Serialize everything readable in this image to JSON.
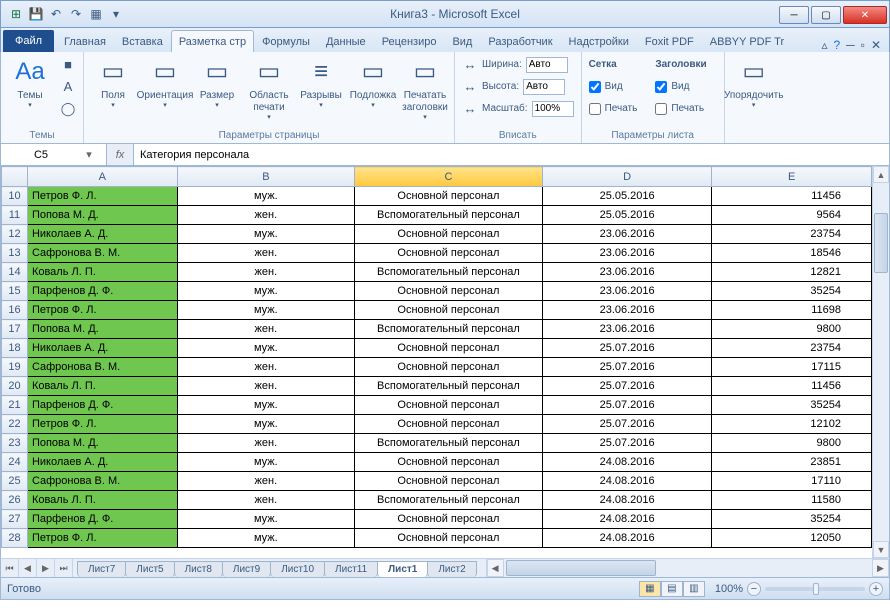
{
  "title": "Книга3  -  Microsoft Excel",
  "qat_icons": [
    "excel",
    "save",
    "undo",
    "redo",
    "print-area",
    "customize"
  ],
  "tabs": {
    "file": "Файл",
    "items": [
      "Главная",
      "Вставка",
      "Разметка стр",
      "Формулы",
      "Данные",
      "Рецензиро",
      "Вид",
      "Разработчик",
      "Надстройки",
      "Foxit PDF",
      "ABBYY PDF Tr"
    ],
    "active_index": 2
  },
  "ribbon": {
    "groups": [
      {
        "label": "Темы",
        "big": [
          {
            "icon": "Aa",
            "text": "Темы"
          }
        ],
        "side": [
          "■",
          "A",
          "◯"
        ]
      },
      {
        "label": "Параметры страницы",
        "big": [
          {
            "icon": "▭",
            "text": "Поля"
          },
          {
            "icon": "▭",
            "text": "Ориентация"
          },
          {
            "icon": "▭",
            "text": "Размер"
          },
          {
            "icon": "▭",
            "text": "Область печати"
          },
          {
            "icon": "≡",
            "text": "Разрывы"
          },
          {
            "icon": "▭",
            "text": "Подложка"
          },
          {
            "icon": "▭",
            "text": "Печатать заголовки"
          }
        ]
      },
      {
        "label": "Вписать",
        "rows": [
          {
            "label": "Ширина:",
            "val": "Авто"
          },
          {
            "label": "Высота:",
            "val": "Авто"
          },
          {
            "label": "Масштаб:",
            "val": "100%"
          }
        ]
      },
      {
        "label": "Параметры листа",
        "cols": [
          {
            "head": "Сетка",
            "c1": "Вид",
            "c2": "Печать"
          },
          {
            "head": "Заголовки",
            "c1": "Вид",
            "c2": "Печать"
          }
        ]
      },
      {
        "label": "",
        "big": [
          {
            "icon": "▭",
            "text": "Упорядочить"
          }
        ]
      }
    ]
  },
  "namebox": "C5",
  "formula": "Категория персонала",
  "columns": [
    "A",
    "B",
    "C",
    "D",
    "E"
  ],
  "selected_col": "C",
  "rows": [
    {
      "n": 10,
      "a": "Петров Ф. Л.",
      "b": "муж.",
      "c": "Основной персонал",
      "d": "25.05.2016",
      "e": "11456"
    },
    {
      "n": 11,
      "a": "Попова М. Д.",
      "b": "жен.",
      "c": "Вспомогательный персонал",
      "d": "25.05.2016",
      "e": "9564"
    },
    {
      "n": 12,
      "a": "Николаев А. Д.",
      "b": "муж.",
      "c": "Основной персонал",
      "d": "23.06.2016",
      "e": "23754"
    },
    {
      "n": 13,
      "a": "Сафронова В. М.",
      "b": "жен.",
      "c": "Основной персонал",
      "d": "23.06.2016",
      "e": "18546"
    },
    {
      "n": 14,
      "a": "Коваль Л. П.",
      "b": "жен.",
      "c": "Вспомогательный персонал",
      "d": "23.06.2016",
      "e": "12821"
    },
    {
      "n": 15,
      "a": "Парфенов Д. Ф.",
      "b": "муж.",
      "c": "Основной персонал",
      "d": "23.06.2016",
      "e": "35254"
    },
    {
      "n": 16,
      "a": "Петров Ф. Л.",
      "b": "муж.",
      "c": "Основной персонал",
      "d": "23.06.2016",
      "e": "11698"
    },
    {
      "n": 17,
      "a": "Попова М. Д.",
      "b": "жен.",
      "c": "Вспомогательный персонал",
      "d": "23.06.2016",
      "e": "9800"
    },
    {
      "n": 18,
      "a": "Николаев А. Д.",
      "b": "муж.",
      "c": "Основной персонал",
      "d": "25.07.2016",
      "e": "23754"
    },
    {
      "n": 19,
      "a": "Сафронова В. М.",
      "b": "жен.",
      "c": "Основной персонал",
      "d": "25.07.2016",
      "e": "17115"
    },
    {
      "n": 20,
      "a": "Коваль Л. П.",
      "b": "жен.",
      "c": "Вспомогательный персонал",
      "d": "25.07.2016",
      "e": "11456"
    },
    {
      "n": 21,
      "a": "Парфенов Д. Ф.",
      "b": "муж.",
      "c": "Основной персонал",
      "d": "25.07.2016",
      "e": "35254"
    },
    {
      "n": 22,
      "a": "Петров Ф. Л.",
      "b": "муж.",
      "c": "Основной персонал",
      "d": "25.07.2016",
      "e": "12102"
    },
    {
      "n": 23,
      "a": "Попова М. Д.",
      "b": "жен.",
      "c": "Вспомогательный персонал",
      "d": "25.07.2016",
      "e": "9800"
    },
    {
      "n": 24,
      "a": "Николаев А. Д.",
      "b": "муж.",
      "c": "Основной персонал",
      "d": "24.08.2016",
      "e": "23851"
    },
    {
      "n": 25,
      "a": "Сафронова В. М.",
      "b": "жен.",
      "c": "Основной персонал",
      "d": "24.08.2016",
      "e": "17110"
    },
    {
      "n": 26,
      "a": "Коваль Л. П.",
      "b": "жен.",
      "c": "Вспомогательный персонал",
      "d": "24.08.2016",
      "e": "11580"
    },
    {
      "n": 27,
      "a": "Парфенов Д. Ф.",
      "b": "муж.",
      "c": "Основной персонал",
      "d": "24.08.2016",
      "e": "35254"
    },
    {
      "n": 28,
      "a": "Петров Ф. Л.",
      "b": "муж.",
      "c": "Основной персонал",
      "d": "24.08.2016",
      "e": "12050"
    }
  ],
  "sheets": {
    "items": [
      "Лист7",
      "Лист5",
      "Лист8",
      "Лист9",
      "Лист10",
      "Лист11",
      "Лист1",
      "Лист2"
    ],
    "active": "Лист1"
  },
  "status": "Готово",
  "zoom": "100%"
}
